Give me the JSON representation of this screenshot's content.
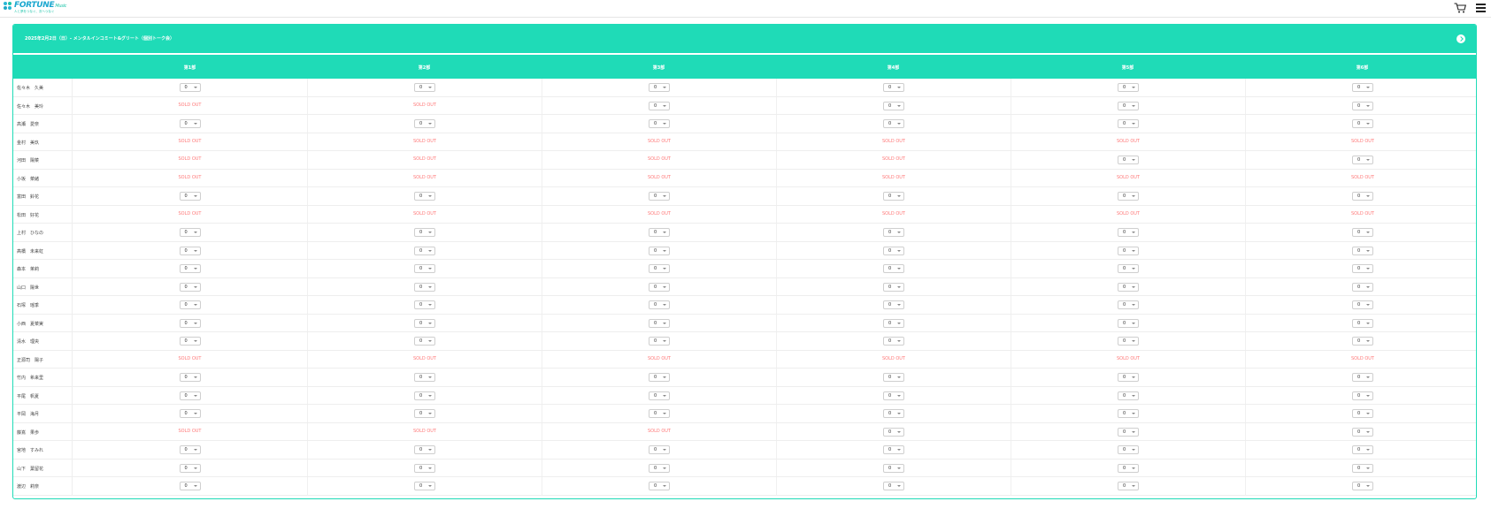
{
  "header": {
    "logo_text": "FORTUNE",
    "logo_suffix": "Music",
    "logo_sub": "人と夢をつなぐ、次へつなぐ"
  },
  "event": {
    "title": "2025年2月2日（日）- メンタルインコミート&グリート（個別トーク会）",
    "slot_headers": [
      "第1部",
      "第2部",
      "第3部",
      "第4部",
      "第5部",
      "第6部"
    ],
    "sold_out_label": "SOLD OUT",
    "rows": [
      {
        "name": "佐々木　久美",
        "slots": [
          "0",
          "0",
          "0",
          "0",
          "0",
          "0"
        ]
      },
      {
        "name": "佐々木　美玲",
        "slots": [
          "SOLD OUT",
          "SOLD OUT",
          "0",
          "0",
          "0",
          "0"
        ]
      },
      {
        "name": "高瀬　愛奈",
        "slots": [
          "0",
          "0",
          "0",
          "0",
          "0",
          "0"
        ]
      },
      {
        "name": "金村　美玖",
        "slots": [
          "SOLD OUT",
          "SOLD OUT",
          "SOLD OUT",
          "SOLD OUT",
          "SOLD OUT",
          "SOLD OUT"
        ]
      },
      {
        "name": "河田　陽菜",
        "slots": [
          "SOLD OUT",
          "SOLD OUT",
          "SOLD OUT",
          "SOLD OUT",
          "0",
          "0"
        ]
      },
      {
        "name": "小坂　菜緒",
        "slots": [
          "SOLD OUT",
          "SOLD OUT",
          "SOLD OUT",
          "SOLD OUT",
          "SOLD OUT",
          "SOLD OUT"
        ]
      },
      {
        "name": "富田　鈴花",
        "slots": [
          "0",
          "0",
          "0",
          "0",
          "0",
          "0"
        ]
      },
      {
        "name": "松田　好花",
        "slots": [
          "SOLD OUT",
          "SOLD OUT",
          "SOLD OUT",
          "SOLD OUT",
          "SOLD OUT",
          "SOLD OUT"
        ]
      },
      {
        "name": "上村　ひなの",
        "slots": [
          "0",
          "0",
          "0",
          "0",
          "0",
          "0"
        ]
      },
      {
        "name": "髙橋　未来虹",
        "slots": [
          "0",
          "0",
          "0",
          "0",
          "0",
          "0"
        ]
      },
      {
        "name": "森本　茉莉",
        "slots": [
          "0",
          "0",
          "0",
          "0",
          "0",
          "0"
        ]
      },
      {
        "name": "山口　陽世",
        "slots": [
          "0",
          "0",
          "0",
          "0",
          "0",
          "0"
        ]
      },
      {
        "name": "石塚　瑶季",
        "slots": [
          "0",
          "0",
          "0",
          "0",
          "0",
          "0"
        ]
      },
      {
        "name": "小西　夏菜実",
        "slots": [
          "0",
          "0",
          "0",
          "0",
          "0",
          "0"
        ]
      },
      {
        "name": "清水　理央",
        "slots": [
          "0",
          "0",
          "0",
          "0",
          "0",
          "0"
        ]
      },
      {
        "name": "正源司　陽子",
        "slots": [
          "SOLD OUT",
          "SOLD OUT",
          "SOLD OUT",
          "SOLD OUT",
          "SOLD OUT",
          "SOLD OUT"
        ]
      },
      {
        "name": "竹内　希来里",
        "slots": [
          "0",
          "0",
          "0",
          "0",
          "0",
          "0"
        ]
      },
      {
        "name": "平尾　帆夏",
        "slots": [
          "0",
          "0",
          "0",
          "0",
          "0",
          "0"
        ]
      },
      {
        "name": "平岡　海月",
        "slots": [
          "0",
          "0",
          "0",
          "0",
          "0",
          "0"
        ]
      },
      {
        "name": "藤嶌　果歩",
        "slots": [
          "SOLD OUT",
          "SOLD OUT",
          "SOLD OUT",
          "0",
          "0",
          "0"
        ]
      },
      {
        "name": "宮地　すみれ",
        "slots": [
          "0",
          "0",
          "0",
          "0",
          "0",
          "0"
        ]
      },
      {
        "name": "山下　葉留花",
        "slots": [
          "0",
          "0",
          "0",
          "0",
          "0",
          "0"
        ]
      },
      {
        "name": "渡辺　莉奈",
        "slots": [
          "0",
          "0",
          "0",
          "0",
          "0",
          "0"
        ]
      }
    ]
  },
  "colors": {
    "accent": "#1fdbb7",
    "sold_out": "#ff7a7a"
  },
  "icons": {
    "cart": "cart-icon",
    "menu": "hamburger-menu-icon",
    "toggle": "chevron-circle-icon"
  }
}
